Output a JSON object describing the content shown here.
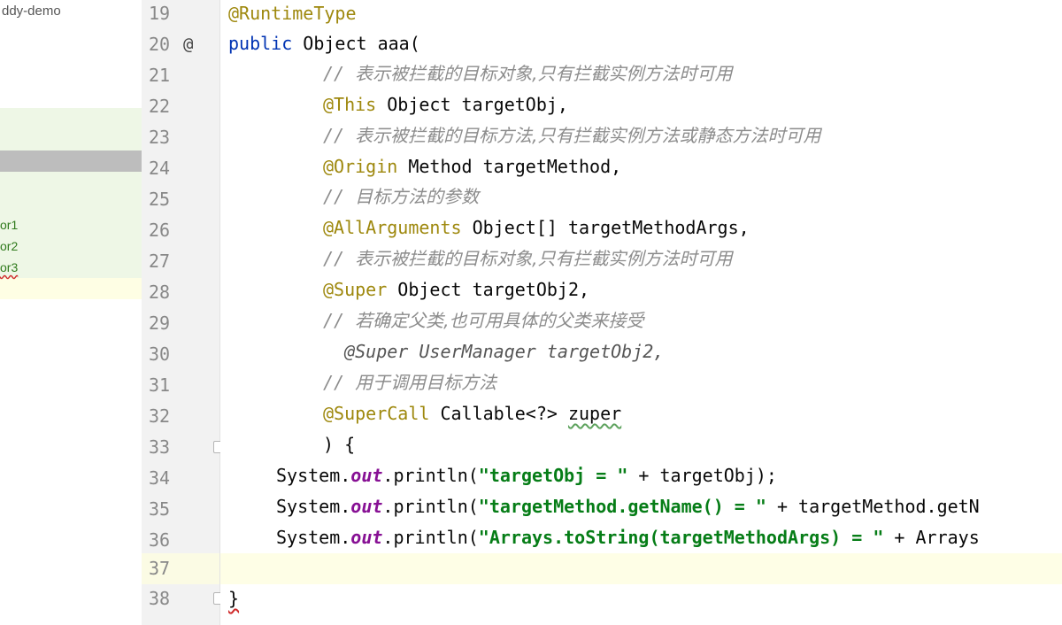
{
  "project_tree": {
    "title": "ddy-demo",
    "nodes": [
      "or1",
      "or2",
      "or3"
    ]
  },
  "gutter": {
    "line_numbers": [
      "19",
      "20",
      "21",
      "22",
      "23",
      "24",
      "25",
      "26",
      "27",
      "28",
      "29",
      "30",
      "31",
      "32",
      "33",
      "34",
      "35",
      "36",
      "37",
      "38"
    ],
    "override_marker": "@",
    "current_line": "37"
  },
  "code": {
    "l19_ann": "@RuntimeType",
    "l20_kw": "public",
    "l20_rest": " Object aaa(",
    "l21_slash": "// ",
    "l21_text": "表示被拦截的目标对象,只有拦截实例方法时可用",
    "l22_ann": "@This",
    "l22_rest": " Object targetObj,",
    "l23_slash": "// ",
    "l23_text": "表示被拦截的目标方法,只有拦截实例方法或静态方法时可用",
    "l24_ann": "@Origin",
    "l24_rest": " Method targetMethod,",
    "l25_slash": "// ",
    "l25_text": "目标方法的参数",
    "l26_ann": "@AllArguments",
    "l26_rest": " Object[] targetMethodArgs,",
    "l27_slash": "// ",
    "l27_text": "表示被拦截的目标对象,只有拦截实例方法时可用",
    "l28_ann": "@Super",
    "l28_rest": " Object targetObj2,",
    "l29_slash": "// ",
    "l29_text": "若确定父类,也可用具体的父类来接受",
    "l30_text": "  @Super UserManager targetObj2,",
    "l31_slash": "// ",
    "l31_text": "用于调用目标方法",
    "l32_ann": "@SuperCall",
    "l32_rest": " Callable<?> ",
    "l32_param": "zuper",
    "l33_text": ") {",
    "l34_a": "System.",
    "l34_out": "out",
    "l34_b": ".println(",
    "l34_str": "\"targetObj = \"",
    "l34_c": " + targetObj);",
    "l35_a": "System.",
    "l35_out": "out",
    "l35_b": ".println(",
    "l35_str": "\"targetMethod.getName() = \"",
    "l35_c": " + targetMethod.getN",
    "l36_a": "System.",
    "l36_out": "out",
    "l36_b": ".println(",
    "l36_str": "\"Arrays.toString(targetMethodArgs) = \"",
    "l36_c": " + Arrays",
    "l38_text": "}"
  },
  "colors": {
    "annotation": "#9e880d",
    "keyword": "#0033b3",
    "comment": "#8c8c8c",
    "string": "#067d17",
    "static_field": "#871094",
    "current_line_bg": "#fefee6"
  }
}
